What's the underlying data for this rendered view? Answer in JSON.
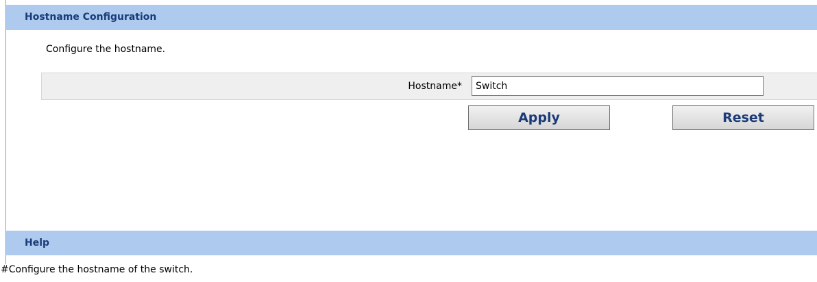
{
  "config_section": {
    "title": "Hostname Configuration",
    "description": "Configure the hostname."
  },
  "form": {
    "hostname_label": "Hostname*",
    "hostname_value": "Switch"
  },
  "buttons": {
    "apply_label": "Apply",
    "reset_label": "Reset"
  },
  "help_section": {
    "title": "Help",
    "text": "#Configure the hostname of the switch."
  },
  "colors": {
    "header_background": "#aecbef",
    "header_text": "#1b3a78",
    "form_row_background": "#efefef"
  }
}
